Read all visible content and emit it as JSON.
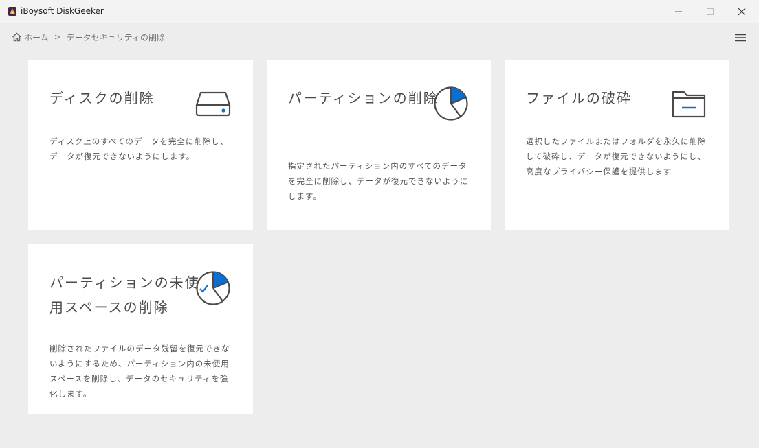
{
  "window": {
    "title": "iBoysoft DiskGeeker",
    "app_icon": "diskgeeker-logo-icon",
    "controls": [
      "minimize-icon",
      "maximize-icon",
      "close-icon"
    ]
  },
  "breadcrumb": {
    "home_icon": "home-icon",
    "home_label": "ホーム",
    "separator": ">",
    "current_label": "データセキュリティの削除"
  },
  "menu_icon": "hamburger-menu-icon",
  "accent_color": "#0a6fd1",
  "cards": [
    {
      "title": "ディスクの削除",
      "icon": "hard-disk-icon",
      "description": "ディスク上のすべてのデータを完全に削除し、データが復元できないようにします。"
    },
    {
      "title": "パーティションの削除",
      "icon": "pie-chart-icon",
      "description": "指定されたパーティション内のすべてのデータを完全に削除し、データが復元できないようにします。"
    },
    {
      "title": "ファイルの破砕",
      "icon": "folder-icon",
      "description": "選択したファイルまたはフォルダを永久に削除して破砕し、データが復元できないようにし、高度なプライバシー保護を提供します"
    },
    {
      "title": "パーティションの未使用スペースの削除",
      "icon": "pie-chart-check-icon",
      "description": "削除されたファイルのデータ残留を復元できないようにするため、パーティション内の未使用スペースを削除し、データのセキュリティを強化します。"
    }
  ]
}
